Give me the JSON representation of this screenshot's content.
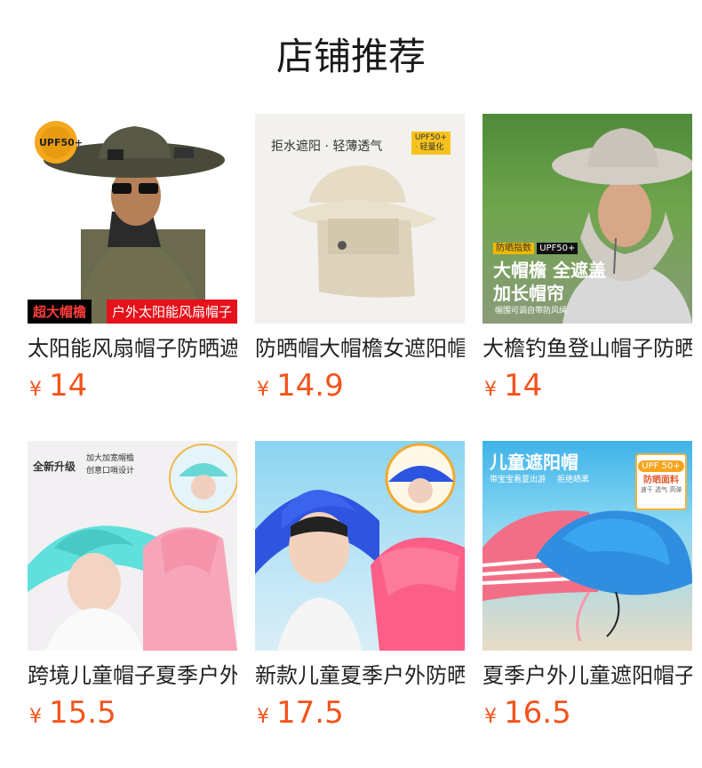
{
  "header": {
    "title": "店铺推荐"
  },
  "products": [
    {
      "name": "太阳能风扇帽子防晒遮阳",
      "currency": "¥",
      "price": "14",
      "image_texts": {
        "badge": "UPF50+",
        "tag_left": "超大帽檐",
        "tag_right": "户外太阳能风扇帽子"
      }
    },
    {
      "name": "防晒帽大帽檐女遮阳帽",
      "currency": "¥",
      "price": "14.9",
      "image_texts": {
        "headline": "拒水遮阳 · 轻薄透气",
        "badge": "UPF50+",
        "badge_sub": "· 轻量化"
      }
    },
    {
      "name": "大檐钓鱼登山帽子防晒",
      "currency": "¥",
      "price": "14",
      "image_texts": {
        "tag": "防晒指数",
        "badge": "UPF50+",
        "line1": "大帽檐 全遮盖",
        "line2": "加长帽帘",
        "small": "帽围可调自带防风绳"
      }
    },
    {
      "name": "跨境儿童帽子夏季户外",
      "currency": "¥",
      "price": "15.5",
      "image_texts": {
        "headline": "全新升级",
        "note1": "加大加宽帽檐",
        "note2": "创意口哨设计"
      }
    },
    {
      "name": "新款儿童夏季户外防晒",
      "currency": "¥",
      "price": "17.5",
      "image_texts": {}
    },
    {
      "name": "夏季户外儿童遮阳帽子",
      "currency": "¥",
      "price": "16.5",
      "image_texts": {
        "headline": "儿童遮阳帽",
        "sub": "带宝宝看夏出游",
        "sub2": "拒绝晒黑",
        "badge": "UPF 50+",
        "badge_label": "防晒面料",
        "badge_small": "速干 透气 高弹"
      }
    }
  ],
  "colors": {
    "price": "#f2541b",
    "title": "#1a1a1a"
  }
}
